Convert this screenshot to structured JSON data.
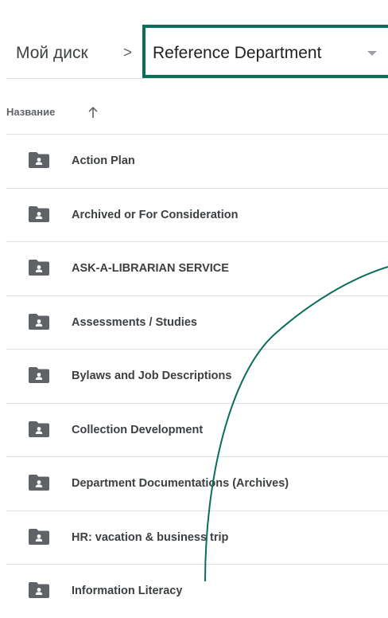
{
  "breadcrumb": {
    "root": "Мой диск",
    "separator": ">",
    "current": "Reference Department"
  },
  "list": {
    "column_header": "Название",
    "sort": "ascending",
    "items": [
      {
        "name": "Action Plan"
      },
      {
        "name": "Archived or For Consideration"
      },
      {
        "name": "ASK-A-LIBRARIAN SERVICE"
      },
      {
        "name": "Assessments / Studies"
      },
      {
        "name": "Bylaws and Job Descriptions"
      },
      {
        "name": "Collection Development"
      },
      {
        "name": "Department Documentations (Archives)"
      },
      {
        "name": "HR: vacation & business trip"
      },
      {
        "name": "Information Literacy"
      }
    ]
  },
  "colors": {
    "highlight": "#0b6e5b",
    "folder_icon": "#5f6368",
    "divider": "#e0e0e0"
  },
  "icons": [
    "shared-folder-icon",
    "arrow-up-icon",
    "caret-down-icon"
  ]
}
